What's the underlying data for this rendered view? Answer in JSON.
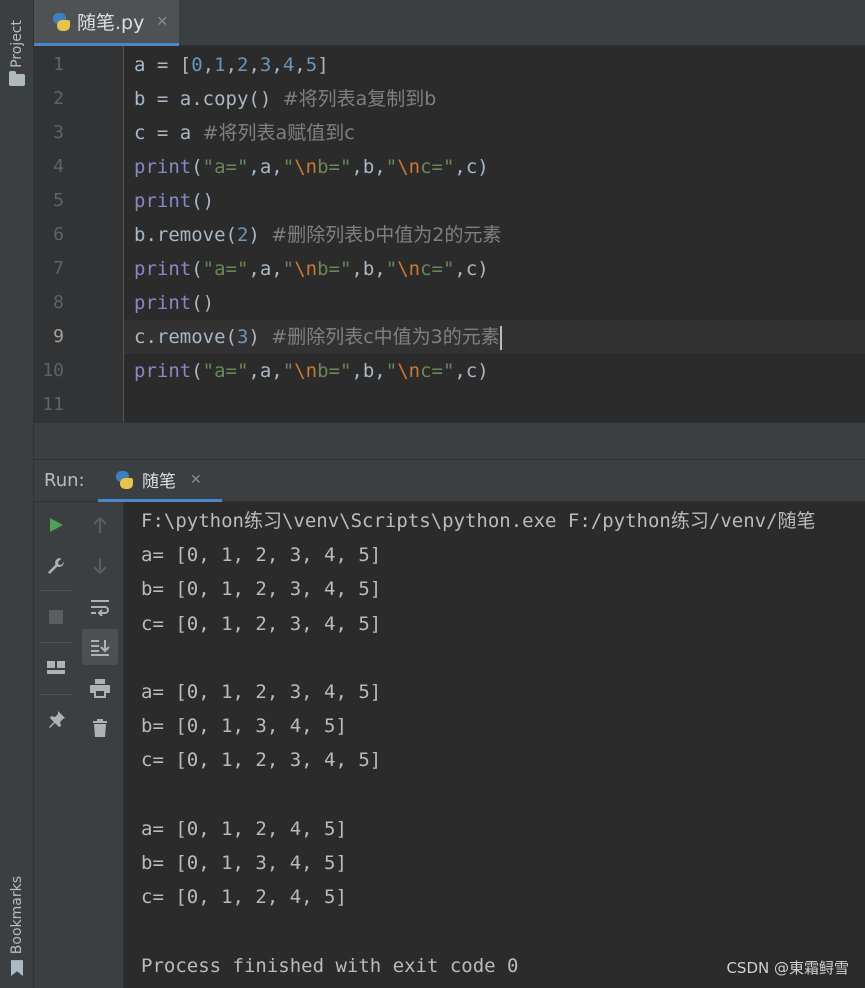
{
  "sidebar": {
    "project_label": "Project",
    "bookmarks_label": "Bookmarks"
  },
  "editor_tab": {
    "label": "随笔.py",
    "close": "✕"
  },
  "code": {
    "current_line": 9,
    "lines": [
      {
        "n": "1",
        "parts": [
          {
            "t": "a = [",
            "c": ""
          },
          {
            "t": "0",
            "c": "num"
          },
          {
            "t": ",",
            "c": ""
          },
          {
            "t": "1",
            "c": "num"
          },
          {
            "t": ",",
            "c": ""
          },
          {
            "t": "2",
            "c": "num"
          },
          {
            "t": ",",
            "c": ""
          },
          {
            "t": "3",
            "c": "num"
          },
          {
            "t": ",",
            "c": ""
          },
          {
            "t": "4",
            "c": "num"
          },
          {
            "t": ",",
            "c": ""
          },
          {
            "t": "5",
            "c": "num"
          },
          {
            "t": "]",
            "c": ""
          }
        ]
      },
      {
        "n": "2",
        "parts": [
          {
            "t": "b = a.copy() ",
            "c": ""
          },
          {
            "t": "#将列表a复制到b",
            "c": "cm"
          }
        ]
      },
      {
        "n": "3",
        "parts": [
          {
            "t": "c = a ",
            "c": ""
          },
          {
            "t": "#将列表a赋值到c",
            "c": "cm"
          }
        ]
      },
      {
        "n": "4",
        "parts": [
          {
            "t": "print",
            "c": "fn"
          },
          {
            "t": "(",
            "c": ""
          },
          {
            "t": "\"a=\"",
            "c": "str"
          },
          {
            "t": ",a,",
            "c": ""
          },
          {
            "t": "\"",
            "c": "str"
          },
          {
            "t": "\\n",
            "c": "esc"
          },
          {
            "t": "b=\"",
            "c": "str"
          },
          {
            "t": ",b,",
            "c": ""
          },
          {
            "t": "\"",
            "c": "str"
          },
          {
            "t": "\\n",
            "c": "esc"
          },
          {
            "t": "c=\"",
            "c": "str"
          },
          {
            "t": ",c)",
            "c": ""
          }
        ]
      },
      {
        "n": "5",
        "parts": [
          {
            "t": "print",
            "c": "fn"
          },
          {
            "t": "()",
            "c": ""
          }
        ]
      },
      {
        "n": "6",
        "parts": [
          {
            "t": "b.remove(",
            "c": ""
          },
          {
            "t": "2",
            "c": "num"
          },
          {
            "t": ") ",
            "c": ""
          },
          {
            "t": "#删除列表b中值为2的元素",
            "c": "cm"
          }
        ]
      },
      {
        "n": "7",
        "parts": [
          {
            "t": "print",
            "c": "fn"
          },
          {
            "t": "(",
            "c": ""
          },
          {
            "t": "\"a=\"",
            "c": "str"
          },
          {
            "t": ",a,",
            "c": ""
          },
          {
            "t": "\"",
            "c": "str"
          },
          {
            "t": "\\n",
            "c": "esc"
          },
          {
            "t": "b=\"",
            "c": "str"
          },
          {
            "t": ",b,",
            "c": ""
          },
          {
            "t": "\"",
            "c": "str"
          },
          {
            "t": "\\n",
            "c": "esc"
          },
          {
            "t": "c=\"",
            "c": "str"
          },
          {
            "t": ",c)",
            "c": ""
          }
        ]
      },
      {
        "n": "8",
        "parts": [
          {
            "t": "print",
            "c": "fn"
          },
          {
            "t": "()",
            "c": ""
          }
        ]
      },
      {
        "n": "9",
        "parts": [
          {
            "t": "c.remove(",
            "c": ""
          },
          {
            "t": "3",
            "c": "num"
          },
          {
            "t": ") ",
            "c": ""
          },
          {
            "t": "#删除列表c中值为3的元素",
            "c": "cm"
          }
        ]
      },
      {
        "n": "10",
        "parts": [
          {
            "t": "print",
            "c": "fn"
          },
          {
            "t": "(",
            "c": ""
          },
          {
            "t": "\"a=\"",
            "c": "str"
          },
          {
            "t": ",a,",
            "c": ""
          },
          {
            "t": "\"",
            "c": "str"
          },
          {
            "t": "\\n",
            "c": "esc"
          },
          {
            "t": "b=\"",
            "c": "str"
          },
          {
            "t": ",b,",
            "c": ""
          },
          {
            "t": "\"",
            "c": "str"
          },
          {
            "t": "\\n",
            "c": "esc"
          },
          {
            "t": "c=\"",
            "c": "str"
          },
          {
            "t": ",c)",
            "c": ""
          }
        ]
      },
      {
        "n": "11",
        "parts": []
      }
    ]
  },
  "run": {
    "label": "Run:",
    "tab_label": "随笔",
    "tab_close": "✕"
  },
  "console": {
    "lines": [
      "F:\\python练习\\venv\\Scripts\\python.exe F:/python练习/venv/随笔",
      "a= [0, 1, 2, 3, 4, 5]",
      "b= [0, 1, 2, 3, 4, 5]",
      "c= [0, 1, 2, 3, 4, 5]",
      "",
      "a= [0, 1, 2, 3, 4, 5]",
      "b= [0, 1, 3, 4, 5]",
      "c= [0, 1, 2, 3, 4, 5]",
      "",
      "a= [0, 1, 2, 4, 5]",
      "b= [0, 1, 3, 4, 5]",
      "c= [0, 1, 2, 4, 5]",
      "",
      "Process finished with exit code 0"
    ]
  },
  "watermark": "CSDN @東霜鲟雪",
  "colors": {
    "background": "#2b2b2b",
    "panel": "#3c3f41",
    "accent": "#4a88c7",
    "run_green": "#4ea255"
  },
  "icons": {
    "toolbar_1": [
      "run-icon",
      "wrench-icon",
      "stop-icon",
      "layout-icon",
      "pin-icon"
    ],
    "toolbar_2": [
      "arrow-up-icon",
      "arrow-down-icon",
      "soft-wrap-icon",
      "scroll-to-end-icon",
      "print-icon",
      "trash-icon"
    ]
  }
}
